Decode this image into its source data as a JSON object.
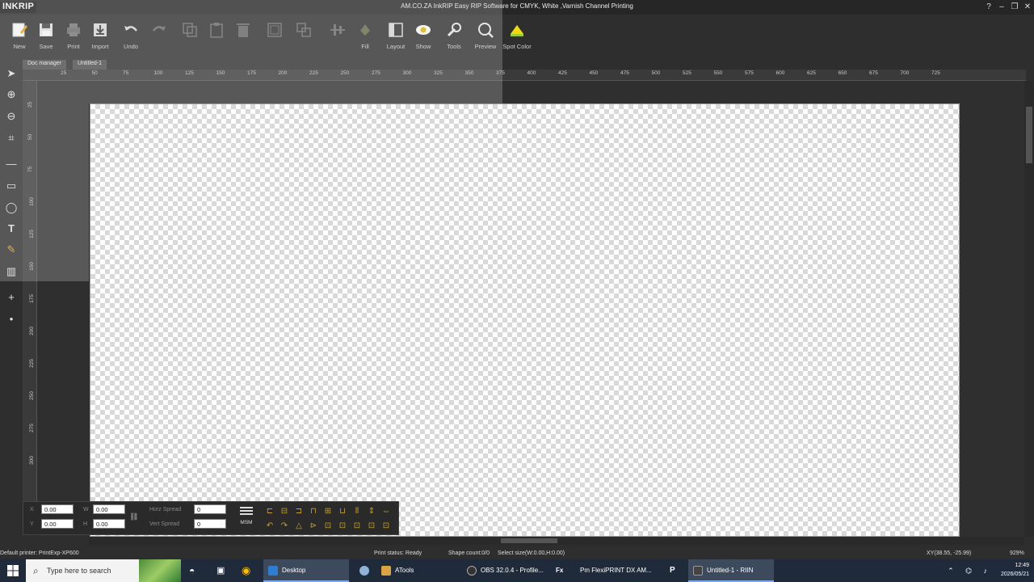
{
  "window": {
    "logo": "INKRIP",
    "title": "AM.CO.ZA InkRIP Easy RIP Software for CMYK, White ,Varnish Channel Printing",
    "controls": [
      "?",
      "–",
      "❐",
      "✕"
    ]
  },
  "toolbar": {
    "items": [
      {
        "label": "New",
        "icon": "new-icon"
      },
      {
        "label": "Save",
        "icon": "save-icon"
      },
      {
        "label": "Print",
        "icon": "print-icon"
      },
      {
        "label": "Import",
        "icon": "import-icon"
      },
      {
        "label": "Undo",
        "icon": "undo-icon"
      },
      {
        "label": "",
        "icon": "redo-icon"
      },
      {
        "label": "",
        "icon": "copy-icon"
      },
      {
        "label": "",
        "icon": "paste-icon"
      },
      {
        "label": "",
        "icon": "delete-icon"
      },
      {
        "label": "",
        "icon": "group-icon"
      },
      {
        "label": "",
        "icon": "ungroup-icon"
      },
      {
        "label": "",
        "icon": "align-icon"
      },
      {
        "label": "Fill",
        "icon": "fill-icon"
      },
      {
        "label": "Layout",
        "icon": "layout-icon"
      },
      {
        "label": "Show",
        "icon": "show-icon"
      },
      {
        "label": "Tools",
        "icon": "tools-icon"
      },
      {
        "label": "Preview",
        "icon": "preview-icon"
      },
      {
        "label": "Spot Color",
        "icon": "spot-color-icon"
      }
    ]
  },
  "tabs": [
    {
      "label": "Doc manager"
    },
    {
      "label": "Untitled-1"
    }
  ],
  "ruler": {
    "h_ticks": [
      "25",
      "50",
      "75",
      "100",
      "125",
      "150",
      "175",
      "200",
      "225",
      "250",
      "275",
      "300",
      "325",
      "350",
      "375",
      "400",
      "425",
      "450",
      "475",
      "500",
      "525",
      "550",
      "575",
      "600",
      "625",
      "650",
      "675",
      "700",
      "725"
    ],
    "v_ticks": [
      "25",
      "50",
      "75",
      "100",
      "125",
      "150",
      "175",
      "200",
      "225",
      "250",
      "275",
      "300"
    ]
  },
  "props": {
    "x_label": "X",
    "y_label": "Y",
    "w_label": "W",
    "h_label": "H",
    "x": "0.00",
    "y": "0.00",
    "w": "0.00",
    "h": "0.00",
    "horz_spread_label": "Horz Spread",
    "vert_spread_label": "Vert Spread",
    "horz_spread": "0",
    "vert_spread": "0",
    "msm": "MSM",
    "align_icons": [
      "⊏",
      "⊟",
      "⊐",
      "⊓",
      "⊞",
      "⊔",
      "⫴",
      "⇕",
      "⇔",
      "↶",
      "↷",
      "△",
      "⊳",
      "⊡",
      "⊡",
      "⊡",
      "⊡",
      "⊡"
    ]
  },
  "status": {
    "printer": "Default printer: PrintExp-XP600",
    "print_status": "Print status: Ready",
    "shape_count": "Shape count:0/0",
    "select_size": "Select size(W:0.00,H:0.00)",
    "xy": "XY(38.55, -25.99)",
    "zoom": "929%"
  },
  "taskbar": {
    "search_placeholder": "Type here to search",
    "items": [
      {
        "label": "Desktop",
        "color": "#2d7dd2"
      },
      {
        "label": "",
        "color": "#8fb3d9"
      },
      {
        "label": "ATools",
        "color": "#d9a441"
      },
      {
        "label": "OBS 32.0.4 - Profile...",
        "color": "#333333"
      },
      {
        "label": "Fx",
        "color": "#1f2b3a"
      },
      {
        "label": "Pm  FlexiPRINT DX AM...",
        "color": "#1f2b3a"
      },
      {
        "label": "P",
        "color": "#1f2b3a"
      },
      {
        "label": "Untitled-1 - RIIN",
        "color": "#444444"
      }
    ],
    "time": "12:49",
    "date": "2026/05/21"
  }
}
